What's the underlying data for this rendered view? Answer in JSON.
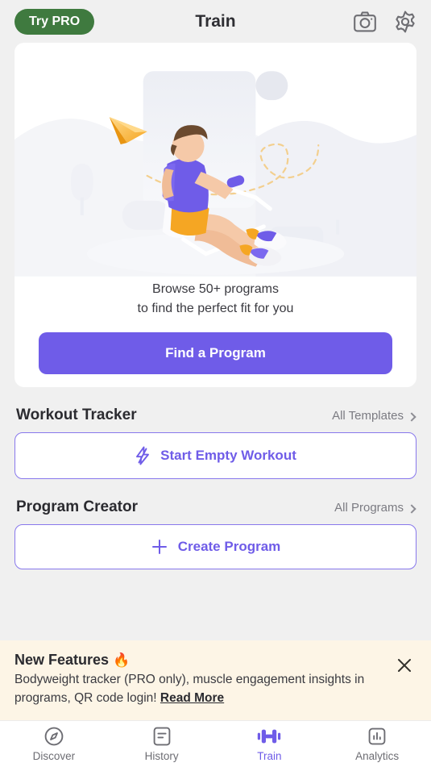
{
  "header": {
    "try_pro_label": "Try PRO",
    "title": "Train",
    "camera_icon": "camera-icon",
    "settings_icon": "gear-icon"
  },
  "hero": {
    "illustration": "rowing-machine-illustration",
    "line1": "Browse 50+ programs",
    "line2": "to find the perfect fit for you",
    "cta_label": "Find a Program"
  },
  "workout_tracker": {
    "title": "Workout Tracker",
    "link_label": "All Templates",
    "button_label": "Start Empty Workout",
    "button_icon": "lightning-bolt-icon"
  },
  "program_creator": {
    "title": "Program Creator",
    "link_label": "All Programs",
    "button_label": "Create Program",
    "button_icon": "plus-icon"
  },
  "banner": {
    "title": "New Features",
    "title_emoji": "🔥",
    "text": "Bodyweight tracker (PRO only), muscle engagement insights in programs, QR code login!",
    "link_label": "Read More",
    "close_icon": "close-icon"
  },
  "bottom_nav": {
    "items": [
      {
        "label": "Discover",
        "icon": "compass-icon",
        "active": false
      },
      {
        "label": "History",
        "icon": "document-icon",
        "active": false
      },
      {
        "label": "Train",
        "icon": "dumbbell-icon",
        "active": true
      },
      {
        "label": "Analytics",
        "icon": "bar-chart-icon",
        "active": false
      }
    ]
  },
  "colors": {
    "accent_purple": "#6f5ce8",
    "pro_green": "#3f7a3f",
    "banner_cream": "#fdf5e6",
    "page_background": "#f0f0f0",
    "illustration_orange": "#f5a623"
  }
}
